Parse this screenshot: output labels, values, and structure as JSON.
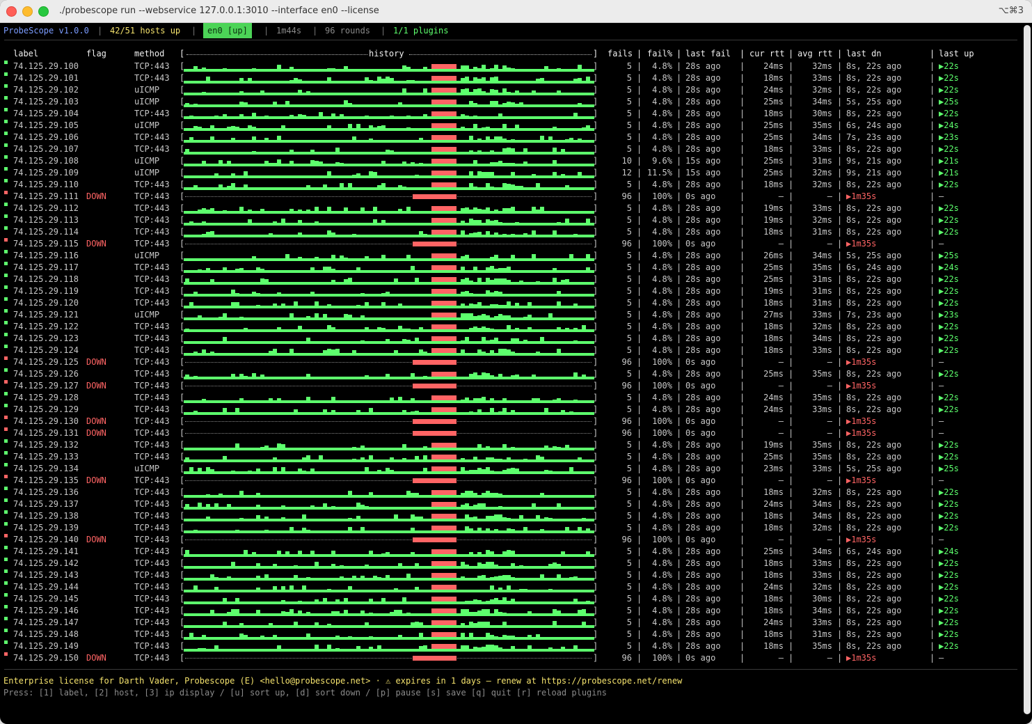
{
  "window": {
    "title": "./probescope run --webservice 127.0.0.1:3010 --interface en0 --license",
    "shortcut": "⌥⌘3"
  },
  "status": {
    "app": "ProbeScope v1.0.0",
    "hosts_up": "42/51 hosts up",
    "iface": "en0 [up]",
    "elapsed": "1m44s",
    "rounds": "96 rounds",
    "plugins": "1/1 plugins"
  },
  "columns": {
    "label": "label",
    "flag": "flag",
    "method": "method",
    "history": "history",
    "fails": "fails",
    "failpct": "fail%",
    "last_fail": "last fail",
    "cur_rtt": "cur rtt",
    "avg_rtt": "avg rtt",
    "last_dn": "last dn",
    "last_up": "last up"
  },
  "colors": {
    "up": "#5dff6d",
    "down": "#ff6464",
    "accent": "#7b9cff",
    "warning": "#f4e26c"
  },
  "rows": [
    {
      "label": "74.125.29.100",
      "flag": "",
      "method": "TCP:443",
      "fails": "5",
      "failpct": "4.8%",
      "last_fail": "28s ago",
      "cur": "24ms",
      "avg": "32ms",
      "dn": "8s, 22s ago",
      "up": "▶22s"
    },
    {
      "label": "74.125.29.101",
      "flag": "",
      "method": "TCP:443",
      "fails": "5",
      "failpct": "4.8%",
      "last_fail": "28s ago",
      "cur": "18ms",
      "avg": "33ms",
      "dn": "8s, 22s ago",
      "up": "▶22s"
    },
    {
      "label": "74.125.29.102",
      "flag": "",
      "method": "uICMP",
      "fails": "5",
      "failpct": "4.8%",
      "last_fail": "28s ago",
      "cur": "24ms",
      "avg": "32ms",
      "dn": "8s, 22s ago",
      "up": "▶22s"
    },
    {
      "label": "74.125.29.103",
      "flag": "",
      "method": "uICMP",
      "fails": "5",
      "failpct": "4.8%",
      "last_fail": "28s ago",
      "cur": "25ms",
      "avg": "34ms",
      "dn": "5s, 25s ago",
      "up": "▶25s"
    },
    {
      "label": "74.125.29.104",
      "flag": "",
      "method": "TCP:443",
      "fails": "5",
      "failpct": "4.8%",
      "last_fail": "28s ago",
      "cur": "18ms",
      "avg": "30ms",
      "dn": "8s, 22s ago",
      "up": "▶22s"
    },
    {
      "label": "74.125.29.105",
      "flag": "",
      "method": "uICMP",
      "fails": "5",
      "failpct": "4.8%",
      "last_fail": "28s ago",
      "cur": "25ms",
      "avg": "35ms",
      "dn": "6s, 24s ago",
      "up": "▶24s"
    },
    {
      "label": "74.125.29.106",
      "flag": "",
      "method": "TCP:443",
      "fails": "5",
      "failpct": "4.8%",
      "last_fail": "28s ago",
      "cur": "25ms",
      "avg": "34ms",
      "dn": "7s, 23s ago",
      "up": "▶23s"
    },
    {
      "label": "74.125.29.107",
      "flag": "",
      "method": "TCP:443",
      "fails": "5",
      "failpct": "4.8%",
      "last_fail": "28s ago",
      "cur": "18ms",
      "avg": "33ms",
      "dn": "8s, 22s ago",
      "up": "▶22s"
    },
    {
      "label": "74.125.29.108",
      "flag": "",
      "method": "uICMP",
      "fails": "10",
      "failpct": "9.6%",
      "last_fail": "15s ago",
      "cur": "25ms",
      "avg": "31ms",
      "dn": "9s, 21s ago",
      "up": "▶21s"
    },
    {
      "label": "74.125.29.109",
      "flag": "",
      "method": "uICMP",
      "fails": "12",
      "failpct": "11.5%",
      "last_fail": "15s ago",
      "cur": "25ms",
      "avg": "32ms",
      "dn": "9s, 21s ago",
      "up": "▶21s"
    },
    {
      "label": "74.125.29.110",
      "flag": "",
      "method": "TCP:443",
      "fails": "5",
      "failpct": "4.8%",
      "last_fail": "28s ago",
      "cur": "18ms",
      "avg": "32ms",
      "dn": "8s, 22s ago",
      "up": "▶22s"
    },
    {
      "label": "74.125.29.111",
      "flag": "DOWN",
      "method": "TCP:443",
      "fails": "96",
      "failpct": "100%",
      "last_fail": "0s ago",
      "cur": "–",
      "avg": "–",
      "dn": "▶1m35s",
      "up": "–"
    },
    {
      "label": "74.125.29.112",
      "flag": "",
      "method": "TCP:443",
      "fails": "5",
      "failpct": "4.8%",
      "last_fail": "28s ago",
      "cur": "19ms",
      "avg": "33ms",
      "dn": "8s, 22s ago",
      "up": "▶22s"
    },
    {
      "label": "74.125.29.113",
      "flag": "",
      "method": "TCP:443",
      "fails": "5",
      "failpct": "4.8%",
      "last_fail": "28s ago",
      "cur": "19ms",
      "avg": "32ms",
      "dn": "8s, 22s ago",
      "up": "▶22s"
    },
    {
      "label": "74.125.29.114",
      "flag": "",
      "method": "TCP:443",
      "fails": "5",
      "failpct": "4.8%",
      "last_fail": "28s ago",
      "cur": "18ms",
      "avg": "31ms",
      "dn": "8s, 22s ago",
      "up": "▶22s"
    },
    {
      "label": "74.125.29.115",
      "flag": "DOWN",
      "method": "TCP:443",
      "fails": "96",
      "failpct": "100%",
      "last_fail": "0s ago",
      "cur": "–",
      "avg": "–",
      "dn": "▶1m35s",
      "up": "–"
    },
    {
      "label": "74.125.29.116",
      "flag": "",
      "method": "uICMP",
      "fails": "5",
      "failpct": "4.8%",
      "last_fail": "28s ago",
      "cur": "26ms",
      "avg": "34ms",
      "dn": "5s, 25s ago",
      "up": "▶25s"
    },
    {
      "label": "74.125.29.117",
      "flag": "",
      "method": "TCP:443",
      "fails": "5",
      "failpct": "4.8%",
      "last_fail": "28s ago",
      "cur": "25ms",
      "avg": "35ms",
      "dn": "6s, 24s ago",
      "up": "▶24s"
    },
    {
      "label": "74.125.29.118",
      "flag": "",
      "method": "TCP:443",
      "fails": "5",
      "failpct": "4.8%",
      "last_fail": "28s ago",
      "cur": "25ms",
      "avg": "31ms",
      "dn": "8s, 22s ago",
      "up": "▶22s"
    },
    {
      "label": "74.125.29.119",
      "flag": "",
      "method": "TCP:443",
      "fails": "5",
      "failpct": "4.8%",
      "last_fail": "28s ago",
      "cur": "19ms",
      "avg": "31ms",
      "dn": "8s, 22s ago",
      "up": "▶22s"
    },
    {
      "label": "74.125.29.120",
      "flag": "",
      "method": "TCP:443",
      "fails": "5",
      "failpct": "4.8%",
      "last_fail": "28s ago",
      "cur": "18ms",
      "avg": "31ms",
      "dn": "8s, 22s ago",
      "up": "▶22s"
    },
    {
      "label": "74.125.29.121",
      "flag": "",
      "method": "uICMP",
      "fails": "5",
      "failpct": "4.8%",
      "last_fail": "28s ago",
      "cur": "27ms",
      "avg": "33ms",
      "dn": "7s, 23s ago",
      "up": "▶23s"
    },
    {
      "label": "74.125.29.122",
      "flag": "",
      "method": "TCP:443",
      "fails": "5",
      "failpct": "4.8%",
      "last_fail": "28s ago",
      "cur": "18ms",
      "avg": "32ms",
      "dn": "8s, 22s ago",
      "up": "▶22s"
    },
    {
      "label": "74.125.29.123",
      "flag": "",
      "method": "TCP:443",
      "fails": "5",
      "failpct": "4.8%",
      "last_fail": "28s ago",
      "cur": "18ms",
      "avg": "34ms",
      "dn": "8s, 22s ago",
      "up": "▶22s"
    },
    {
      "label": "74.125.29.124",
      "flag": "",
      "method": "TCP:443",
      "fails": "5",
      "failpct": "4.8%",
      "last_fail": "28s ago",
      "cur": "18ms",
      "avg": "33ms",
      "dn": "8s, 22s ago",
      "up": "▶22s"
    },
    {
      "label": "74.125.29.125",
      "flag": "DOWN",
      "method": "TCP:443",
      "fails": "96",
      "failpct": "100%",
      "last_fail": "0s ago",
      "cur": "–",
      "avg": "–",
      "dn": "▶1m35s",
      "up": "–"
    },
    {
      "label": "74.125.29.126",
      "flag": "",
      "method": "TCP:443",
      "fails": "5",
      "failpct": "4.8%",
      "last_fail": "28s ago",
      "cur": "25ms",
      "avg": "35ms",
      "dn": "8s, 22s ago",
      "up": "▶22s"
    },
    {
      "label": "74.125.29.127",
      "flag": "DOWN",
      "method": "TCP:443",
      "fails": "96",
      "failpct": "100%",
      "last_fail": "0s ago",
      "cur": "–",
      "avg": "–",
      "dn": "▶1m35s",
      "up": "–"
    },
    {
      "label": "74.125.29.128",
      "flag": "",
      "method": "TCP:443",
      "fails": "5",
      "failpct": "4.8%",
      "last_fail": "28s ago",
      "cur": "24ms",
      "avg": "35ms",
      "dn": "8s, 22s ago",
      "up": "▶22s"
    },
    {
      "label": "74.125.29.129",
      "flag": "",
      "method": "TCP:443",
      "fails": "5",
      "failpct": "4.8%",
      "last_fail": "28s ago",
      "cur": "24ms",
      "avg": "33ms",
      "dn": "8s, 22s ago",
      "up": "▶22s"
    },
    {
      "label": "74.125.29.130",
      "flag": "DOWN",
      "method": "TCP:443",
      "fails": "96",
      "failpct": "100%",
      "last_fail": "0s ago",
      "cur": "–",
      "avg": "–",
      "dn": "▶1m35s",
      "up": "–"
    },
    {
      "label": "74.125.29.131",
      "flag": "DOWN",
      "method": "TCP:443",
      "fails": "96",
      "failpct": "100%",
      "last_fail": "0s ago",
      "cur": "–",
      "avg": "–",
      "dn": "▶1m35s",
      "up": "–"
    },
    {
      "label": "74.125.29.132",
      "flag": "",
      "method": "TCP:443",
      "fails": "5",
      "failpct": "4.8%",
      "last_fail": "28s ago",
      "cur": "19ms",
      "avg": "35ms",
      "dn": "8s, 22s ago",
      "up": "▶22s"
    },
    {
      "label": "74.125.29.133",
      "flag": "",
      "method": "TCP:443",
      "fails": "5",
      "failpct": "4.8%",
      "last_fail": "28s ago",
      "cur": "25ms",
      "avg": "35ms",
      "dn": "8s, 22s ago",
      "up": "▶22s"
    },
    {
      "label": "74.125.29.134",
      "flag": "",
      "method": "uICMP",
      "fails": "5",
      "failpct": "4.8%",
      "last_fail": "28s ago",
      "cur": "23ms",
      "avg": "33ms",
      "dn": "5s, 25s ago",
      "up": "▶25s"
    },
    {
      "label": "74.125.29.135",
      "flag": "DOWN",
      "method": "TCP:443",
      "fails": "96",
      "failpct": "100%",
      "last_fail": "0s ago",
      "cur": "–",
      "avg": "–",
      "dn": "▶1m35s",
      "up": "–"
    },
    {
      "label": "74.125.29.136",
      "flag": "",
      "method": "TCP:443",
      "fails": "5",
      "failpct": "4.8%",
      "last_fail": "28s ago",
      "cur": "18ms",
      "avg": "32ms",
      "dn": "8s, 22s ago",
      "up": "▶22s"
    },
    {
      "label": "74.125.29.137",
      "flag": "",
      "method": "TCP:443",
      "fails": "5",
      "failpct": "4.8%",
      "last_fail": "28s ago",
      "cur": "24ms",
      "avg": "34ms",
      "dn": "8s, 22s ago",
      "up": "▶22s"
    },
    {
      "label": "74.125.29.138",
      "flag": "",
      "method": "TCP:443",
      "fails": "5",
      "failpct": "4.8%",
      "last_fail": "28s ago",
      "cur": "18ms",
      "avg": "34ms",
      "dn": "8s, 22s ago",
      "up": "▶22s"
    },
    {
      "label": "74.125.29.139",
      "flag": "",
      "method": "TCP:443",
      "fails": "5",
      "failpct": "4.8%",
      "last_fail": "28s ago",
      "cur": "18ms",
      "avg": "32ms",
      "dn": "8s, 22s ago",
      "up": "▶22s"
    },
    {
      "label": "74.125.29.140",
      "flag": "DOWN",
      "method": "TCP:443",
      "fails": "96",
      "failpct": "100%",
      "last_fail": "0s ago",
      "cur": "–",
      "avg": "–",
      "dn": "▶1m35s",
      "up": "–"
    },
    {
      "label": "74.125.29.141",
      "flag": "",
      "method": "TCP:443",
      "fails": "5",
      "failpct": "4.8%",
      "last_fail": "28s ago",
      "cur": "25ms",
      "avg": "34ms",
      "dn": "6s, 24s ago",
      "up": "▶24s"
    },
    {
      "label": "74.125.29.142",
      "flag": "",
      "method": "TCP:443",
      "fails": "5",
      "failpct": "4.8%",
      "last_fail": "28s ago",
      "cur": "18ms",
      "avg": "33ms",
      "dn": "8s, 22s ago",
      "up": "▶22s"
    },
    {
      "label": "74.125.29.143",
      "flag": "",
      "method": "TCP:443",
      "fails": "5",
      "failpct": "4.8%",
      "last_fail": "28s ago",
      "cur": "18ms",
      "avg": "33ms",
      "dn": "8s, 22s ago",
      "up": "▶22s"
    },
    {
      "label": "74.125.29.144",
      "flag": "",
      "method": "TCP:443",
      "fails": "5",
      "failpct": "4.8%",
      "last_fail": "28s ago",
      "cur": "24ms",
      "avg": "32ms",
      "dn": "8s, 22s ago",
      "up": "▶22s"
    },
    {
      "label": "74.125.29.145",
      "flag": "",
      "method": "TCP:443",
      "fails": "5",
      "failpct": "4.8%",
      "last_fail": "28s ago",
      "cur": "18ms",
      "avg": "30ms",
      "dn": "8s, 22s ago",
      "up": "▶22s"
    },
    {
      "label": "74.125.29.146",
      "flag": "",
      "method": "TCP:443",
      "fails": "5",
      "failpct": "4.8%",
      "last_fail": "28s ago",
      "cur": "18ms",
      "avg": "34ms",
      "dn": "8s, 22s ago",
      "up": "▶22s"
    },
    {
      "label": "74.125.29.147",
      "flag": "",
      "method": "TCP:443",
      "fails": "5",
      "failpct": "4.8%",
      "last_fail": "28s ago",
      "cur": "24ms",
      "avg": "33ms",
      "dn": "8s, 22s ago",
      "up": "▶22s"
    },
    {
      "label": "74.125.29.148",
      "flag": "",
      "method": "TCP:443",
      "fails": "5",
      "failpct": "4.8%",
      "last_fail": "28s ago",
      "cur": "18ms",
      "avg": "31ms",
      "dn": "8s, 22s ago",
      "up": "▶22s"
    },
    {
      "label": "74.125.29.149",
      "flag": "",
      "method": "TCP:443",
      "fails": "5",
      "failpct": "4.8%",
      "last_fail": "28s ago",
      "cur": "18ms",
      "avg": "35ms",
      "dn": "8s, 22s ago",
      "up": "▶22s"
    },
    {
      "label": "74.125.29.150",
      "flag": "DOWN",
      "method": "TCP:443",
      "fails": "96",
      "failpct": "100%",
      "last_fail": "0s ago",
      "cur": "–",
      "avg": "–",
      "dn": "▶1m35s",
      "up": "–"
    }
  ],
  "footer": {
    "license": "Enterprise license for Darth Vader, Probescope (E) <hello@probescope.net>  ·  ⚠ expires in 1 days – renew at https://probescope.net/renew",
    "keys": "Press: [1] label, [2] host, [3] ip display / [u] sort up, [d] sort down / [p] pause [s] save [q] quit [r] reload plugins"
  }
}
